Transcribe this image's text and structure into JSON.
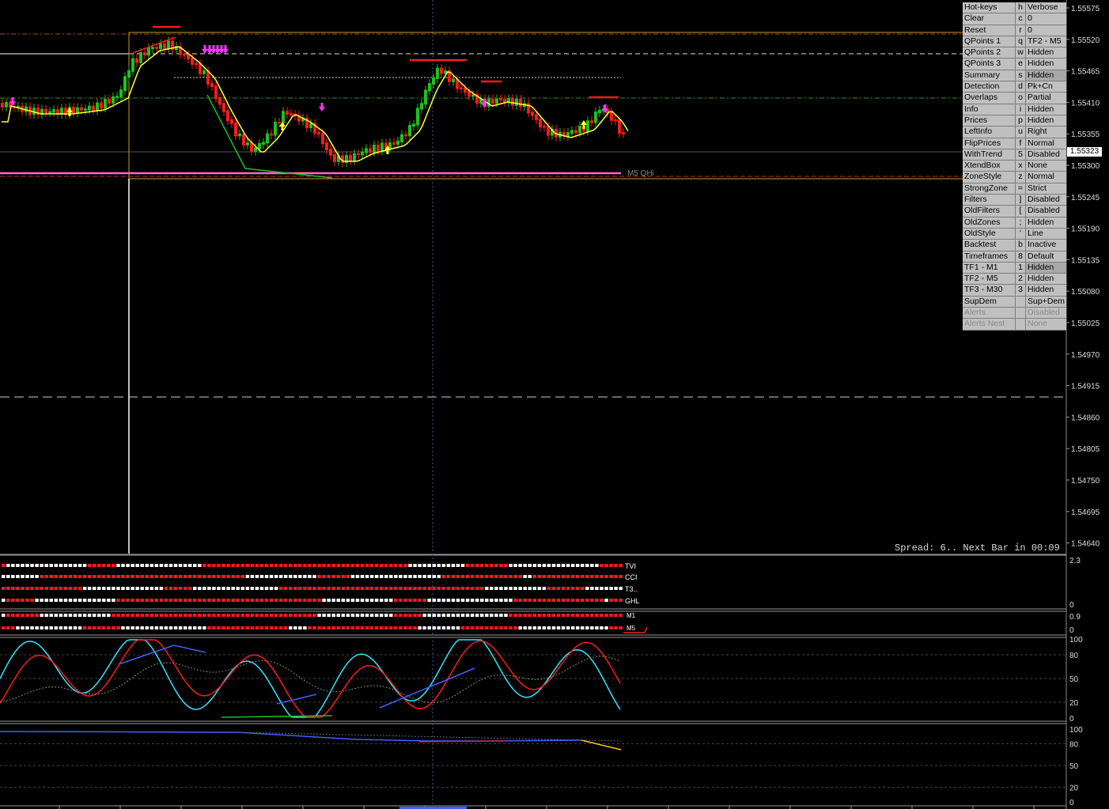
{
  "price_axis": {
    "labels": [
      "1.55575",
      "1.55520",
      "1.55465",
      "1.55410",
      "1.55355",
      "1.55300",
      "1.55245",
      "1.55190",
      "1.55135",
      "1.55080",
      "1.55025",
      "1.54970",
      "1.54915",
      "1.54860",
      "1.54805",
      "1.54750",
      "1.54695",
      "1.54640"
    ],
    "current_price": "1.55323"
  },
  "zone_label": "M5 QHi",
  "spread_text": "Spread: 6.. Next Bar in 00:09",
  "settings_panel": {
    "rows": [
      {
        "name": "Hot-keys",
        "key": "h",
        "value": "Verbose"
      },
      {
        "name": "Clear",
        "key": "c",
        "value": "0"
      },
      {
        "name": "Reset",
        "key": "r",
        "value": "0"
      },
      {
        "name": "QPoints 1",
        "key": "q",
        "value": "TF2 - M5"
      },
      {
        "name": "QPoints 2",
        "key": "w",
        "value": "Hidden"
      },
      {
        "name": "QPoints 3",
        "key": "e",
        "value": "Hidden"
      },
      {
        "name": "Summary",
        "key": "s",
        "value": "Hidden",
        "highlight": true
      },
      {
        "name": "Detection",
        "key": "d",
        "value": "Pk+Cn"
      },
      {
        "name": "Overlaps",
        "key": "o",
        "value": "Partial"
      },
      {
        "name": "Info",
        "key": "i",
        "value": "Hidden"
      },
      {
        "name": "Prices",
        "key": "p",
        "value": "Hidden"
      },
      {
        "name": "LeftInfo",
        "key": "u",
        "value": "Right"
      },
      {
        "name": "FlipPrices",
        "key": "f",
        "value": "Normal"
      },
      {
        "name": "WithTrend",
        "key": "5",
        "value": "Disabled"
      },
      {
        "name": "XtendBox",
        "key": "x",
        "value": "None"
      },
      {
        "name": "ZoneStyle",
        "key": "z",
        "value": "Normal"
      },
      {
        "name": "StrongZone",
        "key": "=",
        "value": "Strict"
      },
      {
        "name": "Filters",
        "key": "]",
        "value": "Disabled"
      },
      {
        "name": "OldFilters",
        "key": "[",
        "value": "Disabled"
      },
      {
        "name": "OldZones",
        "key": ";",
        "value": "Hidden"
      },
      {
        "name": "OldStyle",
        "key": "'",
        "value": "Line"
      },
      {
        "name": "Backtest",
        "key": "b",
        "value": "Inactive"
      },
      {
        "name": "Timeframes",
        "key": "8",
        "value": "Default"
      },
      {
        "name": "TF1 - M1",
        "key": "1",
        "value": "Hidden",
        "highlight": true
      },
      {
        "name": "TF2 - M5",
        "key": "2",
        "value": "Hidden"
      },
      {
        "name": "TF3 - M30",
        "key": "3",
        "value": "Hidden"
      },
      {
        "name": "SupDem",
        "key": "",
        "value": "Sup+Dem"
      },
      {
        "name": "Alerts",
        "key": "",
        "value": "Disabled",
        "dim": true
      },
      {
        "name": "Alerts Nest",
        "key": "",
        "value": "None",
        "dim": true
      }
    ]
  },
  "indicator_rows": {
    "labels": [
      "TVI",
      "CCI",
      "T3..",
      "GHL"
    ],
    "scale": [
      "2.3",
      "0"
    ]
  },
  "tf_rows": {
    "labels": [
      "M1",
      "M5"
    ],
    "scale": [
      "0.9",
      "0"
    ]
  },
  "stoch_scale": [
    "100",
    "80",
    "50",
    "20",
    "0"
  ],
  "rsi_scale": [
    "100",
    "80",
    "50",
    "20",
    "0"
  ],
  "colors": {
    "bull": "#1fbf1f",
    "bear": "#ff1a1a",
    "ma": "#ffff33",
    "arrow": "#ff33ff",
    "zone": "#c8a020",
    "pink_line": "#ff66cc",
    "cyan": "#33e5ff",
    "blue": "#4060ff"
  }
}
